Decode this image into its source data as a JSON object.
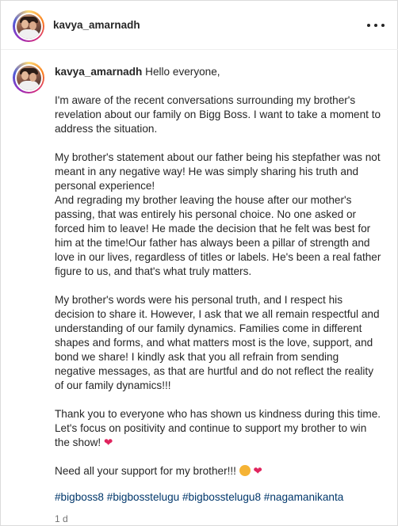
{
  "header": {
    "username": "kavya_amarnadh",
    "more_label": "..."
  },
  "caption": {
    "username": "kavya_amarnadh",
    "greeting": "Hello everyone,",
    "paragraphs": [
      "I'm aware of the recent conversations surrounding my brother's revelation about our family on Bigg Boss. I want to take a moment to address the situation.",
      "My brother's statement about our father being his stepfather was not meant in any negative way! He was simply sharing his truth and personal experience!",
      "And regrading my brother leaving the house after our mother's passing, that was entirely his personal choice. No one asked or forced him to leave! He made the decision that he felt was best for him at the time!Our father has always been a pillar of strength and love in our lives, regardless of titles or labels. He's been a real father figure to us, and that's what truly matters.",
      "My brother's words were his personal truth, and I respect his decision to share it. However, I ask that we all remain respectful and understanding of our family dynamics. Families come in different shapes and forms, and what matters most is the love, support, and bond we share! I kindly ask that you all refrain from sending negative messages, as that are hurtful and do not reflect the reality of our family dynamics!!!",
      "Thank you to everyone who has shown us kindness during this time. Let's focus on positivity and continue to support my brother to win the show!",
      "Need all your support for my brother!!!"
    ],
    "heart_emoji": "❤",
    "hashtags": [
      "#bigboss8",
      "#bigbosstelugu",
      "#bigbosstelugu8",
      "#nagamanikanta"
    ],
    "timestamp": "1 d"
  },
  "icons": {
    "avatar": "profile-photo-icon",
    "more": "more-horizontal-icon",
    "heart": "red-heart-icon",
    "hug": "hugging-face-icon"
  },
  "colors": {
    "text": "#262626",
    "link": "#00376b",
    "muted": "#737373",
    "heart": "#e0245e",
    "border": "#dbdbdb"
  }
}
